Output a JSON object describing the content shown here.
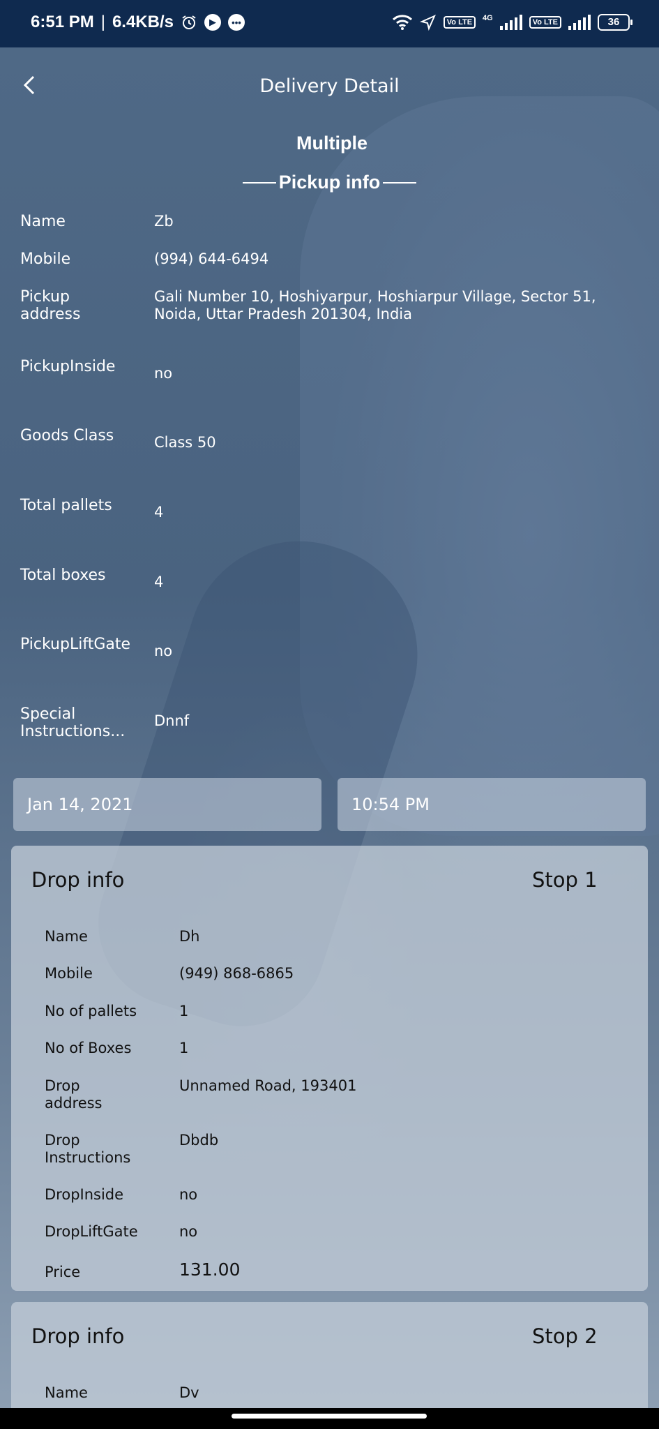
{
  "status_bar": {
    "time": "6:51 PM",
    "speed": "6.4KB/s",
    "battery": "36",
    "network": "4G",
    "volte": "Vo LTE",
    "icons": [
      "alarm-icon",
      "play-icon",
      "message-icon",
      "wifi-icon",
      "location-icon",
      "signal-icon",
      "battery-icon"
    ]
  },
  "header": {
    "title": "Delivery Detail",
    "delivery_type": "Multiple",
    "section_title": "Pickup info"
  },
  "pickup": {
    "name": {
      "label": "Name",
      "value": "Zb"
    },
    "mobile": {
      "label": "Mobile",
      "value": "(994) 644-6494"
    },
    "address": {
      "label": "Pickup address",
      "value": "Gali Number 10, Hoshiyarpur, Hoshiarpur Village, Sector 51, Noida, Uttar Pradesh 201304, India"
    },
    "inside": {
      "label": "PickupInside",
      "value": "no"
    },
    "goods_class": {
      "label": "Goods Class",
      "value": "Class 50"
    },
    "pallets": {
      "label": "Total pallets",
      "value": "4"
    },
    "boxes": {
      "label": "Total boxes",
      "value": "4"
    },
    "liftgate": {
      "label": "PickupLiftGate",
      "value": "no"
    },
    "instructions": {
      "label": "Special Instructions...",
      "value": "Dnnf"
    }
  },
  "schedule": {
    "date": "Jan 14, 2021",
    "time": "10:54 PM"
  },
  "drops": [
    {
      "title": "Drop info",
      "stop": "Stop 1",
      "name": {
        "label": "Name",
        "value": "Dh"
      },
      "mobile": {
        "label": "Mobile",
        "value": "(949) 868-6865"
      },
      "pallets": {
        "label": "No of pallets",
        "value": "1"
      },
      "boxes": {
        "label": "No of Boxes",
        "value": "1"
      },
      "address": {
        "label": "Drop address",
        "value": "Unnamed Road, 193401"
      },
      "instructions": {
        "label": "Drop Instructions",
        "value": "Dbdb"
      },
      "inside": {
        "label": "DropInside",
        "value": "no"
      },
      "liftgate": {
        "label": "DropLiftGate",
        "value": "no"
      },
      "price": {
        "label": "Price",
        "value": "131.00"
      }
    },
    {
      "title": "Drop info",
      "stop": "Stop 2",
      "name": {
        "label": "Name",
        "value": "Dv"
      }
    }
  ],
  "colors": {
    "status_bar": "#0f2a4f",
    "background": "#4d6682",
    "card": "#c0cad6"
  }
}
